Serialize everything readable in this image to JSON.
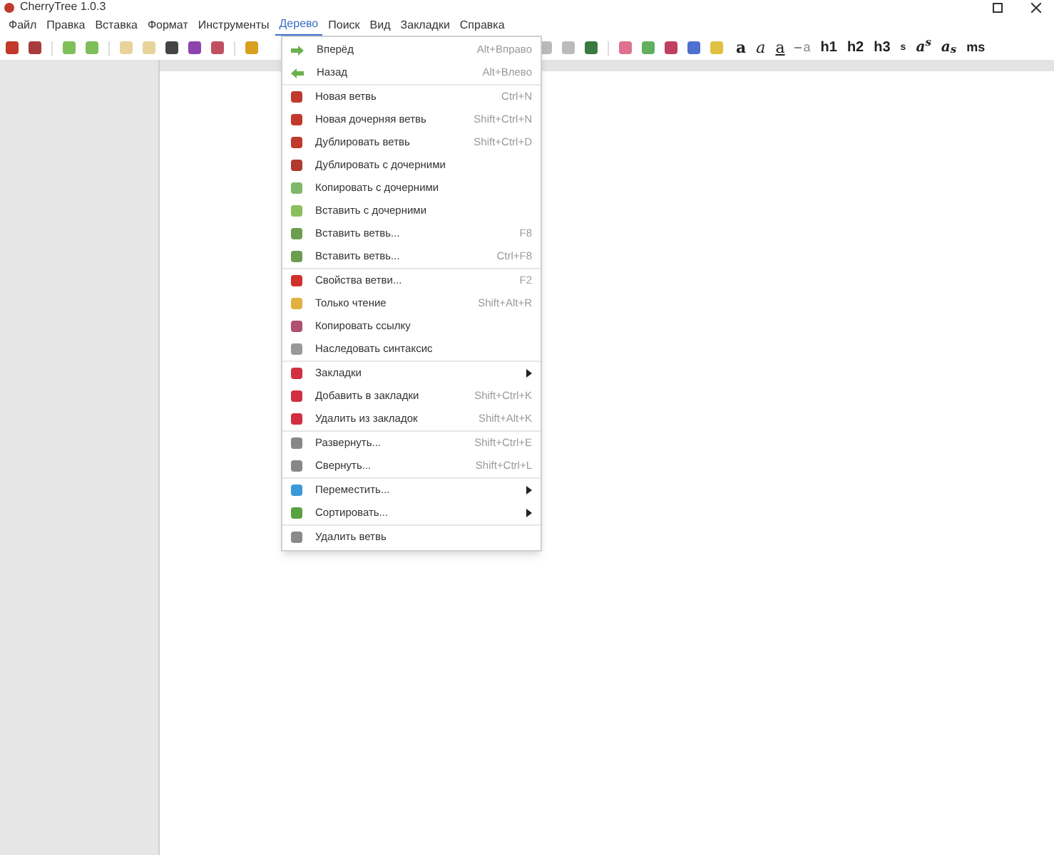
{
  "window": {
    "title": "CherryTree 1.0.3"
  },
  "menubar": [
    {
      "label": "Файл",
      "selected": false
    },
    {
      "label": "Правка",
      "selected": false
    },
    {
      "label": "Вставка",
      "selected": false
    },
    {
      "label": "Формат",
      "selected": false
    },
    {
      "label": "Инструменты",
      "selected": false
    },
    {
      "label": "Дерево",
      "selected": true
    },
    {
      "label": "Поиск",
      "selected": false
    },
    {
      "label": "Вид",
      "selected": false
    },
    {
      "label": "Закладки",
      "selected": false
    },
    {
      "label": "Справка",
      "selected": false
    }
  ],
  "format_buttons": [
    {
      "label": "a",
      "kind": "bold"
    },
    {
      "label": "a",
      "kind": "italic"
    },
    {
      "label": "a",
      "kind": "underline"
    },
    {
      "label": "a",
      "kind": "strike"
    },
    {
      "label": "h1",
      "kind": "plain"
    },
    {
      "label": "h2",
      "kind": "plain"
    },
    {
      "label": "h3",
      "kind": "plain"
    },
    {
      "label": "s",
      "kind": "small"
    },
    {
      "label": "a$^{s}$",
      "kind": "script"
    },
    {
      "label": "a$_{s}$",
      "kind": "script"
    },
    {
      "label": "ms",
      "kind": "mono"
    }
  ],
  "tree_menu": {
    "sections": [
      [
        {
          "label": "Вперёд",
          "shortcut": "Alt+Вправо",
          "kind": "item"
        },
        {
          "label": "Назад",
          "shortcut": "Alt+Влево",
          "kind": "item"
        }
      ],
      [
        {
          "label": "Новая ветвь",
          "shortcut": "Ctrl+N",
          "kind": "item"
        },
        {
          "label": "Новая дочерняя ветвь",
          "shortcut": "Shift+Ctrl+N",
          "kind": "item"
        },
        {
          "label": "Дублировать ветвь",
          "shortcut": "Shift+Ctrl+D",
          "kind": "item"
        },
        {
          "label": "Дублировать с дочерними",
          "kind": "item"
        },
        {
          "label": "Копировать с дочерними",
          "kind": "item"
        },
        {
          "label": "Вставить с дочерними",
          "kind": "item"
        },
        {
          "label": "Вставить ветвь...",
          "shortcut": "F8",
          "kind": "item"
        },
        {
          "label": "Вставить ветвь...",
          "shortcut": "Ctrl+F8",
          "kind": "item"
        }
      ],
      [
        {
          "label": "Свойства ветви...",
          "shortcut": "F2",
          "kind": "item"
        },
        {
          "label": "Только чтение",
          "shortcut": "Shift+Alt+R",
          "kind": "item"
        },
        {
          "label": "Копировать ссылку",
          "kind": "item"
        },
        {
          "label": "Наследовать синтаксис",
          "kind": "item"
        }
      ],
      [
        {
          "label": "Закладки",
          "kind": "submenu"
        },
        {
          "label": "Добавить в закладки",
          "shortcut": "Shift+Ctrl+K",
          "kind": "item"
        },
        {
          "label": "Удалить из закладок",
          "shortcut": "Shift+Alt+K",
          "kind": "item"
        }
      ],
      [
        {
          "label": "Развернуть...",
          "shortcut": "Shift+Ctrl+E",
          "kind": "item"
        },
        {
          "label": "Свернуть...",
          "shortcut": "Shift+Ctrl+L",
          "kind": "item"
        }
      ],
      [
        {
          "label": "Переместить...",
          "kind": "submenu"
        },
        {
          "label": "Сортировать...",
          "kind": "submenu"
        }
      ],
      [
        {
          "label": "Удалить ветвь",
          "kind": "item"
        }
      ]
    ]
  }
}
